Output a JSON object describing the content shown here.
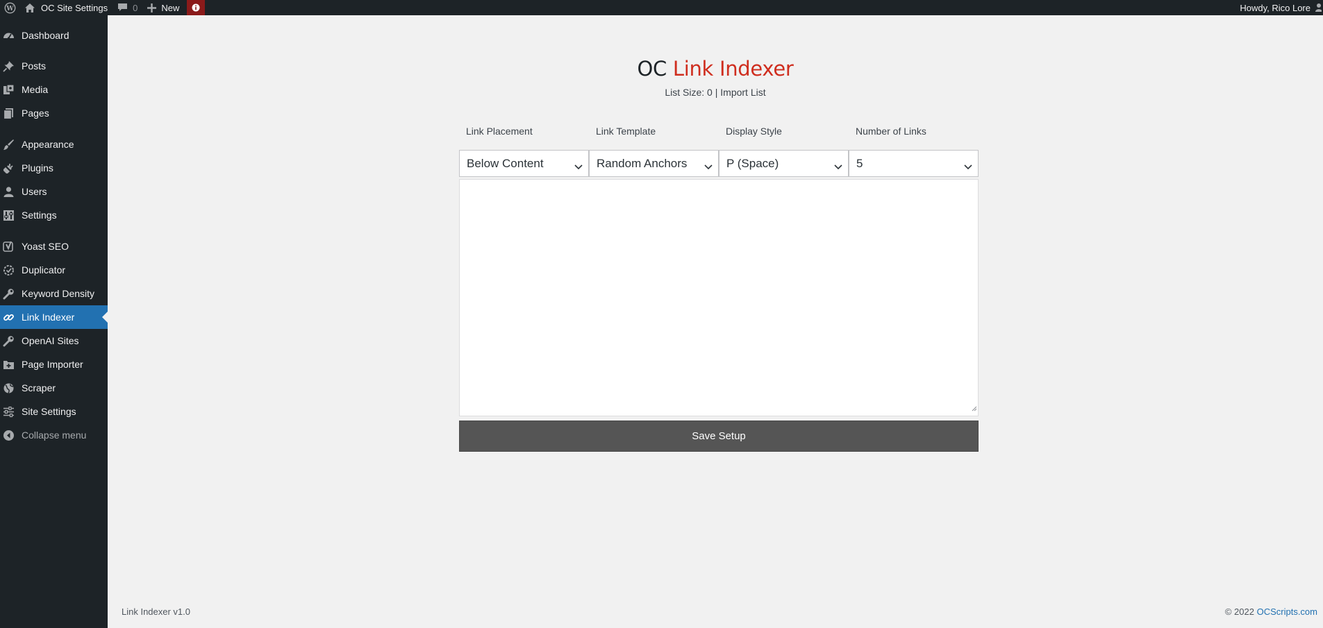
{
  "adminbar": {
    "site_name": "OC Site Settings",
    "comments_count": "0",
    "new_label": "New",
    "howdy": "Howdy, Rico Lore"
  },
  "sidebar": {
    "items": [
      {
        "label": "Dashboard",
        "icon": "dashboard-icon"
      },
      {
        "label": "Posts",
        "icon": "pin-icon"
      },
      {
        "label": "Media",
        "icon": "media-icon"
      },
      {
        "label": "Pages",
        "icon": "pages-icon"
      },
      {
        "label": "Appearance",
        "icon": "brush-icon"
      },
      {
        "label": "Plugins",
        "icon": "plug-icon"
      },
      {
        "label": "Users",
        "icon": "user-icon"
      },
      {
        "label": "Settings",
        "icon": "settings-icon"
      },
      {
        "label": "Yoast SEO",
        "icon": "yoast-icon"
      },
      {
        "label": "Duplicator",
        "icon": "duplicator-icon"
      },
      {
        "label": "Keyword Density",
        "icon": "wrench-icon"
      },
      {
        "label": "Link Indexer",
        "icon": "link-icon"
      },
      {
        "label": "OpenAI Sites",
        "icon": "wrench-icon"
      },
      {
        "label": "Page Importer",
        "icon": "folder-plus-icon"
      },
      {
        "label": "Scraper",
        "icon": "globe-icon"
      },
      {
        "label": "Site Settings",
        "icon": "sliders-icon"
      },
      {
        "label": "Collapse menu",
        "icon": "collapse-icon"
      }
    ],
    "active_item": "Link Indexer"
  },
  "main": {
    "title_prefix": "OC",
    "title_accent": "Link Indexer",
    "list_size_label": "List Size: 0",
    "separator": "|",
    "import_link": "Import List",
    "fields": [
      {
        "label": "Link Placement",
        "value": "Below Content"
      },
      {
        "label": "Link Template",
        "value": "Random Anchors"
      },
      {
        "label": "Display Style",
        "value": "P (Space)"
      },
      {
        "label": "Number of Links",
        "value": "5"
      }
    ],
    "textarea_value": "",
    "save_label": "Save Setup"
  },
  "footer": {
    "version": "Link Indexer v1.0",
    "copyright": "© 2022",
    "site_link": "OCScripts.com"
  },
  "colors": {
    "accent_red": "#cf2e1f",
    "active_blue": "#2271b1",
    "sidebar_bg": "#1d2327",
    "button_bg": "#555555"
  }
}
